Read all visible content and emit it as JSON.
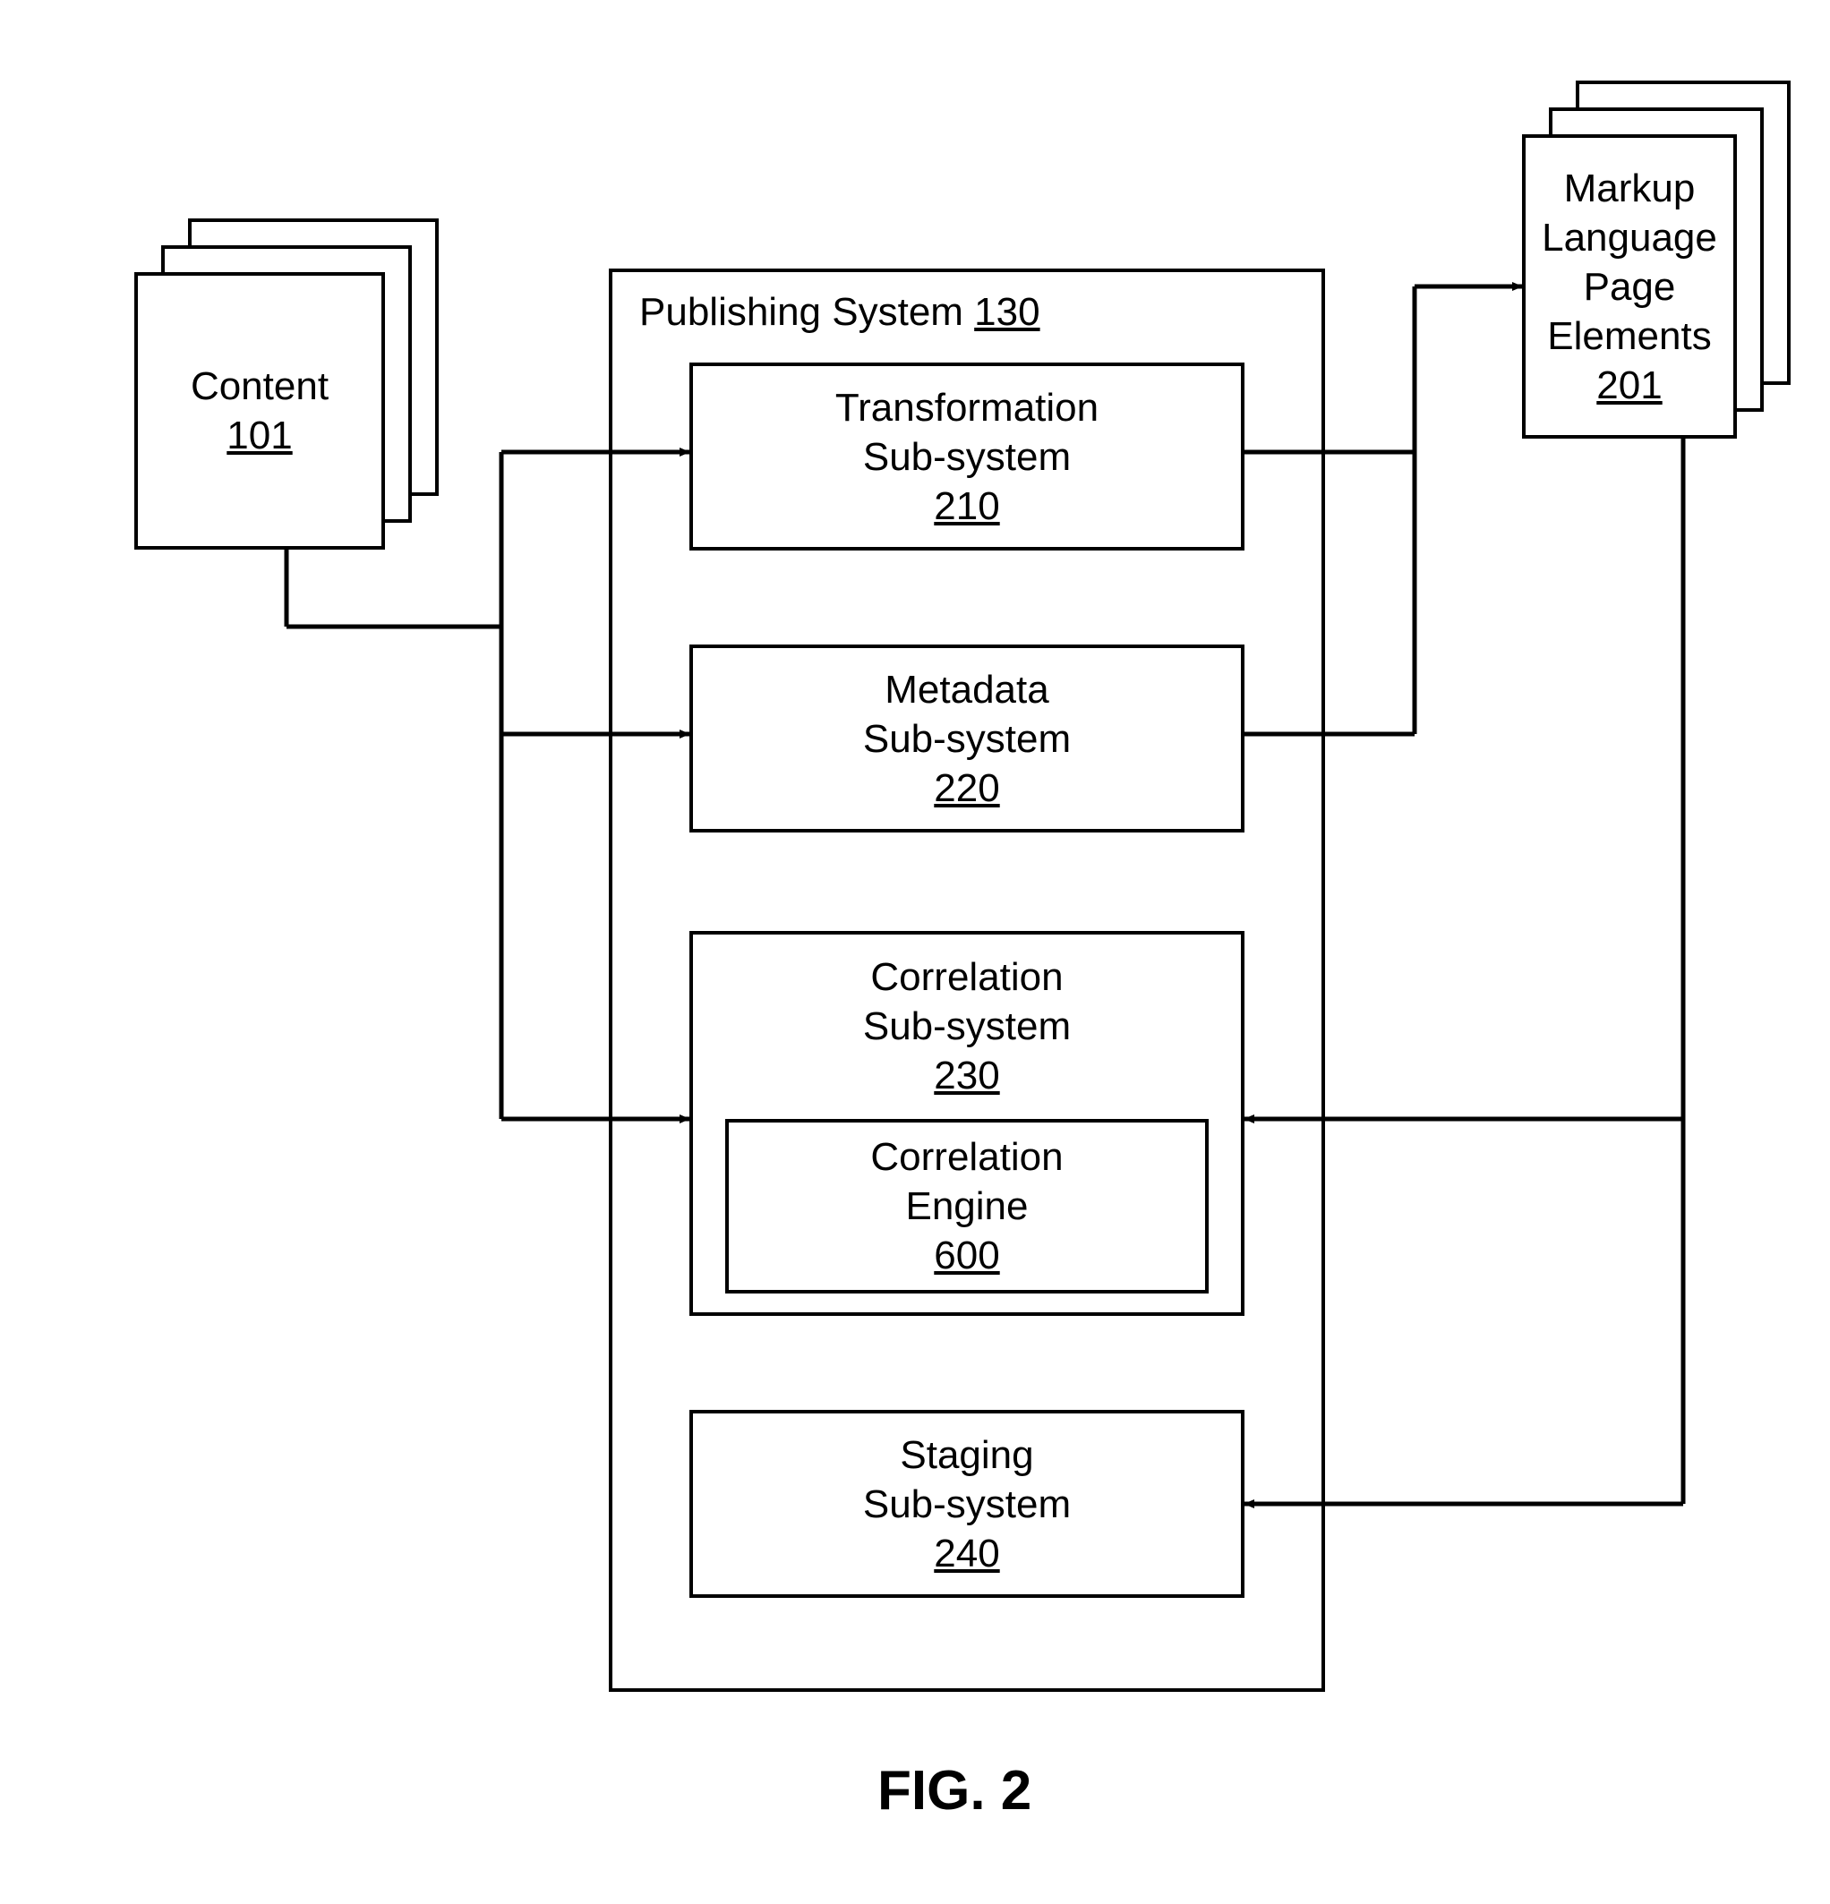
{
  "figure_caption": "FIG. 2",
  "content_stack": {
    "title": "Content",
    "ref": "101"
  },
  "markup_stack": {
    "line1": "Markup",
    "line2": "Language",
    "line3": "Page",
    "line4": "Elements",
    "ref": "201"
  },
  "publishing_system": {
    "title_prefix": "Publishing System ",
    "title_ref": "130"
  },
  "transformation": {
    "line1": "Transformation",
    "line2": "Sub-system",
    "ref": "210"
  },
  "metadata": {
    "line1": "Metadata",
    "line2": "Sub-system",
    "ref": "220"
  },
  "correlation": {
    "line1": "Correlation",
    "line2": "Sub-system",
    "ref": "230"
  },
  "correlation_engine": {
    "line1": "Correlation",
    "line2": "Engine",
    "ref": "600"
  },
  "staging": {
    "line1": "Staging",
    "line2": "Sub-system",
    "ref": "240"
  }
}
